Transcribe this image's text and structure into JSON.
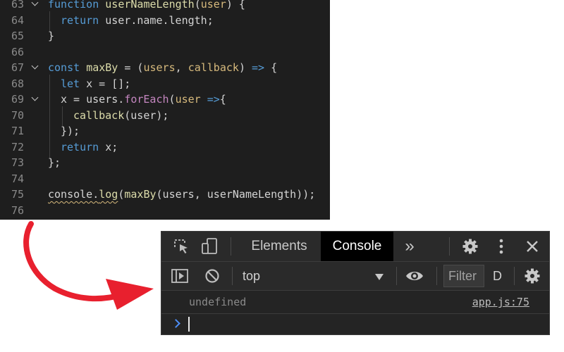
{
  "editor": {
    "lines": [
      {
        "num": "63",
        "parts": [
          {
            "t": "function",
            "c": "kw"
          },
          {
            "t": " "
          },
          {
            "t": "userNameLength",
            "c": "fn"
          },
          {
            "t": "("
          },
          {
            "t": "user",
            "c": "pm"
          },
          {
            "t": ") {"
          }
        ]
      },
      {
        "num": "64",
        "parts": [
          {
            "t": "return",
            "c": "kw"
          },
          {
            "t": " user.name.length;"
          }
        ]
      },
      {
        "num": "65",
        "parts": [
          {
            "t": "}"
          }
        ]
      },
      {
        "num": "66",
        "parts": []
      },
      {
        "num": "67",
        "parts": [
          {
            "t": "const",
            "c": "kw"
          },
          {
            "t": " "
          },
          {
            "t": "maxBy",
            "c": "fn"
          },
          {
            "t": " = ("
          },
          {
            "t": "users",
            "c": "pm"
          },
          {
            "t": ", "
          },
          {
            "t": "callback",
            "c": "pm"
          },
          {
            "t": ") "
          },
          {
            "t": "=>",
            "c": "ar"
          },
          {
            "t": " {"
          }
        ]
      },
      {
        "num": "68",
        "parts": [
          {
            "t": "let",
            "c": "kw"
          },
          {
            "t": " x = [];"
          }
        ]
      },
      {
        "num": "69",
        "parts": [
          {
            "t": "x = users."
          },
          {
            "t": "forEach",
            "c": "meth"
          },
          {
            "t": "("
          },
          {
            "t": "user",
            "c": "pm"
          },
          {
            "t": " "
          },
          {
            "t": "=>",
            "c": "ar"
          },
          {
            "t": "{"
          }
        ]
      },
      {
        "num": "70",
        "parts": [
          {
            "t": "callback",
            "c": "fn"
          },
          {
            "t": "(user);"
          }
        ]
      },
      {
        "num": "71",
        "parts": [
          {
            "t": "});"
          }
        ]
      },
      {
        "num": "72",
        "parts": [
          {
            "t": "return",
            "c": "kw"
          },
          {
            "t": " x;"
          }
        ]
      },
      {
        "num": "73",
        "parts": [
          {
            "t": "};"
          }
        ]
      },
      {
        "num": "74",
        "parts": []
      },
      {
        "num": "75",
        "parts": [
          {
            "t": "console.",
            "c": "sq"
          },
          {
            "t": "log",
            "c": "fnsq"
          },
          {
            "t": "("
          },
          {
            "t": "maxBy",
            "c": "fn"
          },
          {
            "t": "(users, userNameLength));"
          }
        ]
      },
      {
        "num": "76",
        "parts": []
      }
    ]
  },
  "devtools": {
    "tabs": [
      "Elements",
      "Console"
    ],
    "active_tab": "Console",
    "more_tabs_symbol": "»",
    "context": "top",
    "filter_placeholder": "Filter",
    "levels_label": "D",
    "messages": [
      {
        "text": "undefined",
        "source": "app.js:75"
      }
    ]
  },
  "colors": {
    "arrow": "#e8202e",
    "editor_bg": "#1e1e1e",
    "devtools_bg": "#242424",
    "prompt_chevron": "#4d8ef7"
  },
  "icons": [
    "inspect-element-icon",
    "device-toolbar-icon",
    "gear-icon",
    "kebab-menu-icon",
    "close-icon",
    "sidebar-toggle-icon",
    "clear-console-icon",
    "dropdown-triangle-icon",
    "eye-icon",
    "prompt-chevron-icon"
  ]
}
